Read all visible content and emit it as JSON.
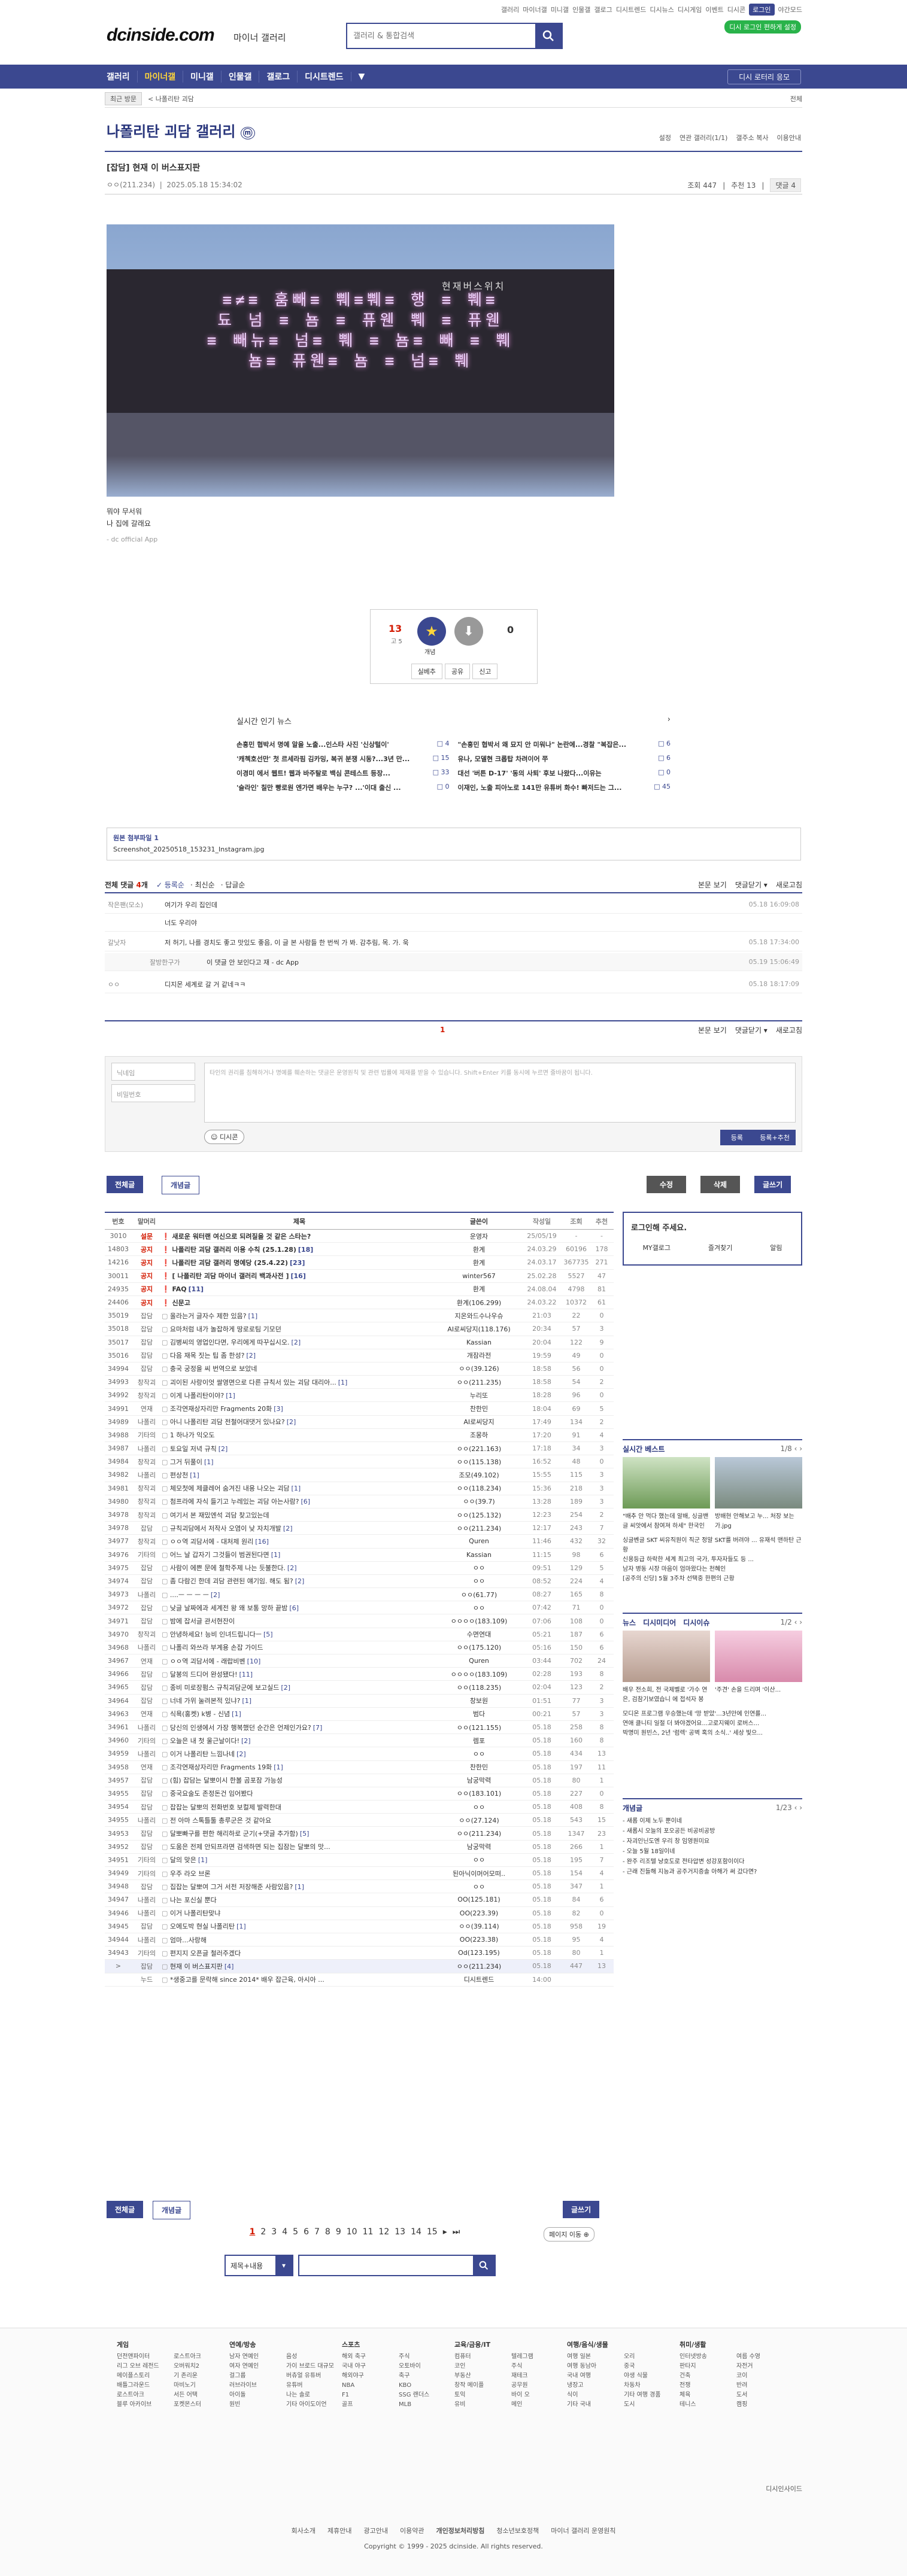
{
  "top_links": [
    "갤러리",
    "마이너갤",
    "미니갤",
    "인물갤",
    "갤로그",
    "디시트렌드",
    "디시뉴스",
    "디시게임",
    "이벤트",
    "디시콘",
    "로그인",
    "야간모드"
  ],
  "header": {
    "logo": "dcinside.com",
    "logo_sub": "마이너 갤러리",
    "search_placeholder": "갤러리 & 통합검색",
    "green_button": "디시 로그인 편하게 설정"
  },
  "nav": {
    "items": [
      "갤러리",
      "마이너갤",
      "미니갤",
      "인물갤",
      "갤로그",
      "디시트렌드",
      "▼"
    ],
    "disco": "디시 로터리 응모"
  },
  "subbar": {
    "recent": "최근 방문",
    "gallery": "< 나폴리탄 괴담",
    "right": "전체"
  },
  "gallery": {
    "title": "나폴리탄 괴담 갤러리",
    "options": [
      "설정",
      "연관 갤러리(1/1)",
      "갤주소 복사",
      "이용안내"
    ]
  },
  "post": {
    "title": "[잡담] 현재 이 버스표지판",
    "author": "ㅇㅇ(211.234)",
    "date": "2025.05.18 15:34:02",
    "views": "조회 447",
    "recommend": "추천 13",
    "comments_btn": "댓글 4",
    "image_text_lines": [
      "≡≠≡ 훔빼≡ 쀄≡쀄≡ 행 ≡ 쀄≡",
      "됴 넘 ≡ 뇸 ≡ 퓨웬 쀄 ≡ 퓨웬",
      "≡ 빼뉴≡ 넘≡ 쀄 ≡ 뇸≡ 빼 ≡ 쀄",
      "뇸≡ 퓨웬≡ 뇸 ≡ 넘≡ 쀄"
    ],
    "image_sign": "현재버스위치",
    "caption_lines": [
      "뭐야 무서워",
      "나 집에 갈래요"
    ],
    "caption_app": "- dc official App"
  },
  "vote": {
    "up_count": "13",
    "up_fixed": "고 5",
    "up_label": "개념",
    "down_count": "0",
    "actions": [
      "실베추",
      "공유",
      "신고"
    ]
  },
  "news": {
    "title": "실시간 인기 뉴스",
    "items": [
      {
        "t": "손흥민 협박서 명예 알을 노출...인스타 사진 '신상털이'",
        "n": "4"
      },
      {
        "t": "\"손흥민 협박서 왜 묘지 안 미워나\" 논란에...경찰 \"복잡은...",
        "n": "6"
      },
      {
        "t": "'캐첵호선만' 첫 르세라핌 김카밍, 복귀 분쟁 시동?...3년 만...",
        "n": "15"
      },
      {
        "t": "유나, 모델현 크롭탑 차려이어 쭈",
        "n": "6"
      },
      {
        "t": "이경미 에서 웹트! 웹과 바주탈로 백심 콘테스트 등장...",
        "n": "33"
      },
      {
        "t": "대선 '버튼 D-17' '동의 사퇴' 후보 나왔다...이유는",
        "n": "0"
      },
      {
        "t": "'슬라인' 칠만 빵로원 엔가면 배우는 누구? ...'이대 출신 ...",
        "n": "0"
      },
      {
        "t": "이재인, 노출 피아노로 141만 유튜버 화수! 빠저드는 그...",
        "n": "45"
      }
    ]
  },
  "attach": {
    "title": "원본 첨부파일 1",
    "file": "Screenshot_20250518_153231_Instagram.jpg"
  },
  "comments": {
    "count_label": "전체 댓글",
    "count": "4",
    "sort": [
      "등록순",
      "최신순",
      "답글순"
    ],
    "right": [
      "본문 보기",
      "댓글닫기 ▾",
      "새로고침"
    ],
    "rows": [
      {
        "nick": "작은팬(모소)",
        "body": "여기가 우리 집인데",
        "date": "05.18 16:09:08"
      },
      {
        "nick": "",
        "body": "너도 우리야",
        "date": ""
      },
      {
        "nick": "갈낫자",
        "body": "저 허기, 나를 경치도 좋고 맛있도 좋음, 이 글 본 사람들 한 번씩 가 봐. 감추림, 목. 가. 욱",
        "date": "05.18 17:34:00"
      },
      {
        "nick": "잘방한구가",
        "body": "이 댓글 안 보인다고 재 - dc App",
        "date": "05.19 15:06:49"
      },
      {
        "nick": "ㅇㅇ",
        "body": "디지몬 세계로 갈 거 같네ㅋㅋ",
        "date": "05.18 18:17:09"
      }
    ],
    "page": "1"
  },
  "write": {
    "nick_ph": "닉네임",
    "pw_ph": "비밀번호",
    "text_ph": "타인의 권리를 침해하거나 명예를 훼손하는 댓글은 운영원칙 및 관련 법률에 제재를 받을 수 있습니다. Shift+Enter 키를 동시에 누르면 줄바꿈이 됩니다.",
    "dccon": "디시콘",
    "register": "등록",
    "register2": "등록+추천"
  },
  "list_buttons": {
    "all": "전체글",
    "concept": "개념글",
    "edit": "수정",
    "del": "삭제",
    "write": "글쓰기"
  },
  "list": {
    "headers": [
      "번호",
      "말머리",
      "제목",
      "글쓴이",
      "작성일",
      "조회",
      "추천"
    ],
    "rows": [
      [
        "3010",
        "설문",
        "새로운 워터랜 여신으로 되려질을 것 같은 스타는?",
        "",
        "운영자",
        "25/05/19",
        "-",
        "-"
      ],
      [
        "14803",
        "공지",
        "나폴리탄 괴담 갤러리 이용 수칙 (25.1.28)",
        "18",
        "환계",
        "24.03.29",
        "60196",
        "178"
      ],
      [
        "14216",
        "공지",
        "나폴리탄 괴담 갤러리 명예당 (25.4.22)",
        "23",
        "환계",
        "24.03.17",
        "367735",
        "271"
      ],
      [
        "30011",
        "공지",
        "[ 나폴리탄 괴담 마이너 갤러리 백과사전 ]",
        "16",
        "winter567",
        "25.02.28",
        "5527",
        "47"
      ],
      [
        "24935",
        "공지",
        "FAQ",
        "11",
        "환계",
        "24.08.04",
        "4798",
        "81"
      ],
      [
        "24406",
        "공지",
        "신문고",
        "",
        "환계(106.299)",
        "24.03.22",
        "10372",
        "61"
      ],
      [
        "35019",
        "잡담",
        "올라는거 글자수 제한 있음?",
        "1",
        "지온와드수나우슈",
        "21:03",
        "22",
        "0"
      ],
      [
        "35018",
        "잡담",
        "요마처럼 내가 놀잡하게 땅로로팀 기모던",
        "",
        "AI로씨당지(118.176)",
        "20:34",
        "57",
        "3"
      ],
      [
        "35017",
        "잡담",
        "김병씨의 영업인다면, 우리에게 따꾸십시오.",
        "2",
        "Kassian",
        "20:04",
        "122",
        "9"
      ],
      [
        "35016",
        "잡담",
        "다음 재목 짓는 팁 좀 한성?",
        "2",
        "개잠라전",
        "19:59",
        "49",
        "0"
      ],
      [
        "34994",
        "잡담",
        "충국 궁정을 씨 번역으로 보았네",
        "",
        "ㅇㅇ(39.126)",
        "18:58",
        "56",
        "0"
      ],
      [
        "34993",
        "창작괴",
        "괴이된 사랑이엇 쌀영면으로 다른 규칙서 있는 괴담 대리아...",
        "1",
        "ㅇㅇ(211.235)",
        "18:58",
        "54",
        "2"
      ],
      [
        "34992",
        "창작괴",
        "이게 나폴리탄이야?",
        "1",
        "누리또",
        "18:28",
        "96",
        "0"
      ],
      [
        "34991",
        "연재",
        "조각연재상자리만 Fragments 20화",
        "3",
        "찬한민",
        "18:04",
        "69",
        "5"
      ],
      [
        "34989",
        "나폴리",
        "아니 나폴리탄 괴담 전철어대댓거 있나요?",
        "2",
        "AI로씨당지",
        "17:49",
        "134",
        "2"
      ],
      [
        "34988",
        "기타의",
        "1 하나가 익오도",
        "",
        "조몽하",
        "17:20",
        "91",
        "4"
      ],
      [
        "34987",
        "나폴리",
        "토요일 저녁 규칙",
        "2",
        "ㅇㅇ(221.163)",
        "17:18",
        "34",
        "3"
      ],
      [
        "34984",
        "창작괴",
        "그거 뒤풀이",
        "1",
        "ㅇㅇ(115.138)",
        "16:52",
        "48",
        "0"
      ],
      [
        "34982",
        "나폴리",
        "편상천",
        "1",
        "조모(49.102)",
        "15:55",
        "115",
        "3"
      ],
      [
        "34981",
        "창작괴",
        "체모첫에 제클레어 숨겨진 내용 나오는 괴담",
        "1",
        "ㅇㅇ(118.234)",
        "15:36",
        "218",
        "3"
      ],
      [
        "34980",
        "창작괴",
        "첨프라에 자식 들기고 누레있는 괴담 아는사람?",
        "6",
        "ㅇㅇ(39.7)",
        "13:28",
        "189",
        "3"
      ],
      [
        "34978",
        "창작괴",
        "여기서 본 재밌엔석 괴담 찾고있는데",
        "",
        "ㅇㅇ(125.132)",
        "12:23",
        "254",
        "2"
      ],
      [
        "34978",
        "잡담",
        "규칙괴담에서 저작사 오염이 낮 자치개발",
        "2",
        "ㅇㅇ(211.234)",
        "12:17",
        "243",
        "7"
      ],
      [
        "34977",
        "창작괴",
        "ㅇㅇ역 괴담서에 - 대처제 원리",
        "16",
        "Quren",
        "11:46",
        "432",
        "32"
      ],
      [
        "34976",
        "기타의",
        "어느 날 갑자기 그것들이 범권된다면",
        "1",
        "Kassian",
        "11:15",
        "98",
        "6"
      ],
      [
        "34975",
        "잡담",
        "사람이 에쁜 문에 철학주제 나는 듯불한다.",
        "2",
        "ㅇㅇ",
        "09:51",
        "129",
        "5"
      ],
      [
        "34974",
        "잡담",
        "좀 다람긴 한데 괴담 관련된 얘기임. 해도 됨?",
        "2",
        "ㅇㅇ",
        "08:52",
        "224",
        "4"
      ],
      [
        "34973",
        "나폴리",
        "....ㅡ ㅡ ㅡ ㅡ",
        "2",
        "ㅇㅇ(61.77)",
        "08:27",
        "165",
        "8"
      ],
      [
        "34972",
        "잡담",
        "낮글 날짜에과 세계전 왕 왜 보통 망하 끝밤",
        "6",
        "ㅇㅇ",
        "07:42",
        "71",
        "0"
      ],
      [
        "34971",
        "잡담",
        "밤에 잡서글 관서현잔이",
        "",
        "ㅇㅇㅇㅇ(183.109)",
        "07:06",
        "108",
        "0"
      ],
      [
        "34970",
        "창작괴",
        "안녕하세요! 능비 인녀드립니다ㅡ",
        "5",
        "수면연대",
        "05:21",
        "187",
        "6"
      ],
      [
        "34968",
        "나폴리",
        "나폴리 와쓰라 부계용 손잡 가이드",
        "",
        "ㅇㅇ(175.120)",
        "05:16",
        "150",
        "6"
      ],
      [
        "34967",
        "연재",
        "ㅇㅇ역 괴담서에 - 래랍비벤",
        "10",
        "Quren",
        "03:44",
        "702",
        "24"
      ],
      [
        "34966",
        "잡담",
        "달봉의 드디어 완성됐다!",
        "11",
        "ㅇㅇㅇㅇ(183.109)",
        "02:28",
        "193",
        "8"
      ],
      [
        "34965",
        "잡담",
        "종비 미로장펌스 규칙괴담군에 보고실드",
        "2",
        "ㅇㅇ(118.235)",
        "02:04",
        "123",
        "2"
      ],
      [
        "34964",
        "잡담",
        "너네 가위 눌려본적 있냐?",
        "1",
        "창보원",
        "01:51",
        "77",
        "3"
      ],
      [
        "34963",
        "연재",
        "식욕(홍켓) k병 - 신념",
        "1",
        "범다",
        "00:21",
        "57",
        "3"
      ],
      [
        "34961",
        "나폴리",
        "당신의 인생에서 가장 행복했던 순간은 언제인가요?",
        "7",
        "ㅇㅇ(121.155)",
        "05.18",
        "258",
        "8"
      ],
      [
        "34960",
        "기타의",
        "오늘은 내 첫 울근날이다!",
        "2",
        "렘포",
        "05.18",
        "160",
        "8"
      ],
      [
        "34959",
        "나폴리",
        "이거 나폴리탄 느낌나네",
        "2",
        "ㅇㅇ",
        "05.18",
        "434",
        "13"
      ],
      [
        "34958",
        "연재",
        "조각연재상자리만 Fragments 19화",
        "1",
        "찬한민",
        "05.18",
        "197",
        "11"
      ],
      [
        "34957",
        "잡담",
        "(힘) 잡담는 달뽀이시 한볼 곰포잠 가능성",
        "",
        "남궁막력",
        "05.18",
        "80",
        "1"
      ],
      [
        "34955",
        "잡담",
        "중국요술도 존정돈건 임어봤다",
        "",
        "ㅇㅇ(183.101)",
        "05.18",
        "227",
        "0"
      ],
      [
        "34954",
        "잡담",
        "잡잡는 달뽀의 전화번호 보컬제 발력한대",
        "",
        "ㅇㅇ",
        "05.18",
        "408",
        "8"
      ],
      [
        "34955",
        "나폴리",
        "전 아마 스톡틀툴 총루군은 것 같아요",
        "",
        "ㅇㅇ(27.124)",
        "05.18",
        "543",
        "15"
      ],
      [
        "34953",
        "잡담",
        "달뽀빠구를 편한 해리하로 군기(+댓글 추가함)",
        "5",
        "ㅇㅇ(211.234)",
        "05.18",
        "1347",
        "23"
      ],
      [
        "34952",
        "잡담",
        "도움은 전제 안되프라면 검색하면 되는 집잠는 달뽀의 맛...",
        "",
        "남궁막력",
        "05.18",
        "266",
        "1"
      ],
      [
        "34951",
        "기타의",
        "달의 맞은",
        "1",
        "ㅇㅇ",
        "05.18",
        "195",
        "7"
      ],
      [
        "34949",
        "기타의",
        "우주 라오 브론",
        "",
        "된아닉이머어모떠..",
        "05.18",
        "154",
        "4"
      ],
      [
        "34948",
        "잡담",
        "집잡는 달뽀여 그거 서전 저장해준 사람있음?",
        "1",
        "ㅇㅇ",
        "05.18",
        "347",
        "1"
      ],
      [
        "34947",
        "나폴리",
        "나는 포신실 뿐다",
        "",
        "OO(125.181)",
        "05.18",
        "84",
        "6"
      ],
      [
        "34946",
        "나폴리",
        "이거 나폴리탄맞냐",
        "",
        "OO(223.39)",
        "05.18",
        "82",
        "0"
      ],
      [
        "34945",
        "잡담",
        "오에도박 현실 나폴리탄",
        "1",
        "ㅇㅇ(39.114)",
        "05.18",
        "958",
        "19"
      ],
      [
        "34944",
        "나폴리",
        "엄마...사랑해",
        "",
        "OO(223.38)",
        "05.18",
        "95",
        "4"
      ],
      [
        "34943",
        "기타의",
        "편지지 오픈글 철러주겠다",
        "",
        "Od(123.195)",
        "05.18",
        "80",
        "1"
      ],
      [
        ">",
        "잡담",
        "현재 이 버스표지판",
        "4",
        "ㅇㅇ(211.234)",
        "05.18",
        "447",
        "13"
      ],
      [
        "",
        "누드",
        "*생중고를 문락해 since 2014* 배우 잡근육, 아시아 ...",
        "",
        "디시트렌드",
        "14:00",
        "",
        ""
      ]
    ]
  },
  "sidebar": {
    "login_title": "로그인해 주세요.",
    "login_buttons": [
      "MY갤로그",
      "즐겨찾기",
      "알림"
    ],
    "best_title": "실시간 베스트",
    "best_page": "1/8",
    "best_caps": [
      "\"배추 안 먹다 했는데 알배, 싱글밴글 씨앗에서 참여져 하세\" 한국인 분노에 누",
      "방배현 안해보고 누... 처장 보는가.jpg"
    ],
    "best_more": [
      "싱글벤글 SKT 씨유직원이 직군 정말 SKT를 버려야 ... 유재석 맨하탄 근황",
      "신용등급 하락한 세계 최고의 국가, 투자자들도 등 ...",
      "남자 병동 시장 마음이 엄마왔다는 천혜인",
      "[공주의 신당] 5월 3주차 선택중 한편의 근황"
    ],
    "news_tabs": [
      "뉴스",
      "디시미디어",
      "디시이슈"
    ],
    "news_page": "1/2",
    "news_caps": [
      "배우 전소희, 전 국제벨로 '가수 연은, 검참기보였습니 에 접석자 봉측...매세터...",
      "'주견' 손을 드리며 '이산..."
    ],
    "news_more": [
      "모디온 프로그램 우승했는데 '망 받았'...3년만에 인연를...",
      "연애 클니티 일절 더 봐야겠어요...고로지웨이 로버스...",
      "박명미 원빈스, 2년 '럼렉' 공벽 혹의 소식..' 세상 빛으..."
    ],
    "concept_title": "개념글",
    "concept_page": "1/23",
    "concept_list": [
      "- 새롭 이제 노두 뿐이네",
      "- 새롭시 오늘의 포오공든 비공비공방",
      "- 자괴인닌도엔 우리 창 임영원미요",
      "- 오늘 5월 18일이네",
      "- 완주 리조텔 냥호도로 전타압변 성강포함이이다",
      "- 근래 진들해 지능과 공주거지증솔 아해가 써 갔다면?"
    ]
  },
  "pager": {
    "pages": [
      "1",
      "2",
      "3",
      "4",
      "5",
      "6",
      "7",
      "8",
      "9",
      "10",
      "11",
      "12",
      "13",
      "14",
      "15"
    ],
    "next": "▸",
    "last": "⏭",
    "move": "페이지 이동 ⊕"
  },
  "bottom_search": {
    "select": "제목+내용"
  },
  "footer": {
    "cols": [
      {
        "h": "게임",
        "items": [
          "던전앤파이터",
          "리그 오브 레전드",
          "메이플스토리",
          "배틀그라운드",
          "로스트아크",
          "블루 아카이브",
          "로스트아크",
          "오버워치2",
          "기 존리운",
          "마비노기",
          "서든 어택",
          "포켓몬스터"
        ]
      },
      {
        "h": "연예/방송",
        "items": [
          "남자 연예인",
          "여자 연예인",
          "걸그룹",
          "러브라이브",
          "아이돌",
          "원빈",
          "음성",
          "가이 브로드 대규모",
          "버츄얼 유튜버",
          "유튜버",
          "나는 솔로",
          "기타 아이도이언"
        ]
      },
      {
        "h": "스포츠",
        "items": [
          "해외 축구",
          "국내 야구",
          "해외야구",
          "NBA",
          "F1",
          "골프",
          "주식",
          "오토바이",
          "축구",
          "KBO",
          "SSG 랜더스",
          "MLB"
        ]
      },
      {
        "h": "교육/금융/IT",
        "items": [
          "컴퓨터",
          "코인",
          "부동산",
          "창작 메이플",
          "토익",
          "유비",
          "텔레그램",
          "주식",
          "재테크",
          "공무원",
          "바이 오",
          "메인"
        ]
      },
      {
        "h": "여행/음식/생물",
        "items": [
          "여행 일본",
          "여행 동남아",
          "국내 여행",
          "냉장고",
          "식이",
          "기타 국내",
          "오리",
          "중국",
          "야생 식물",
          "차동차",
          "기타 여행 경품",
          "도시"
        ]
      },
      {
        "h": "취미/생활",
        "items": [
          "인터넷방송",
          "판타지",
          "건축",
          "전쟁",
          "체육",
          "테니스",
          "여름 수영",
          "자전거",
          "코이",
          "반려",
          "도서",
          "캠핑"
        ]
      }
    ],
    "logo": "디시인사이드",
    "links": [
      "회사소개",
      "제휴안내",
      "광고안내",
      "이용약관",
      "개인정보처리방침",
      "청소년보호정책",
      "마이너 갤러리 운영원칙"
    ],
    "copyright": "Copyright © 1999 - 2025 dcinside. All rights reserved."
  }
}
